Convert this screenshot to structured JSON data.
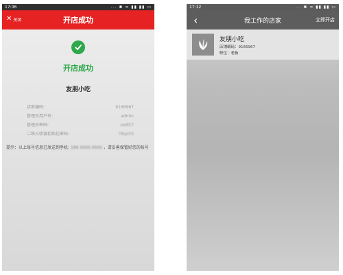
{
  "left": {
    "status_time": "17:06",
    "status_icons": "... ✱ ≈ ▮▮ ▮▮ ▭",
    "close_label": "关闭",
    "title": "开店成功",
    "success_text": "开店成功",
    "store_name": "友朋小吃",
    "info": [
      {
        "label": "店家编码:",
        "value": "9166967",
        "blurred": false
      },
      {
        "label": "管理员用户名:",
        "value": "admin",
        "blurred": false
      },
      {
        "label": "管理员密码:",
        "value": "sw857",
        "blurred": true
      },
      {
        "label": "二维火收银初始化密码:",
        "value": "78qx03",
        "blurred": true
      }
    ],
    "tip_prefix": "提示：以上账号信息已发送到手机:",
    "tip_phone": "186 0000 0000",
    "tip_suffix": "，请妥善保管好您的账号"
  },
  "right": {
    "status_time": "17:12",
    "status_icons": "... ✱ ≈ ▮▮ ▮▮ ▭",
    "title": "我工作的店家",
    "open_store_label": "立即开店",
    "card": {
      "name": "友朋小吃",
      "code_line": "店铺编码：9166967",
      "role_line": "职位：老板"
    }
  },
  "colors": {
    "red": "#e62222",
    "green": "#2ea84b",
    "gray_header": "#5d5d5d"
  }
}
